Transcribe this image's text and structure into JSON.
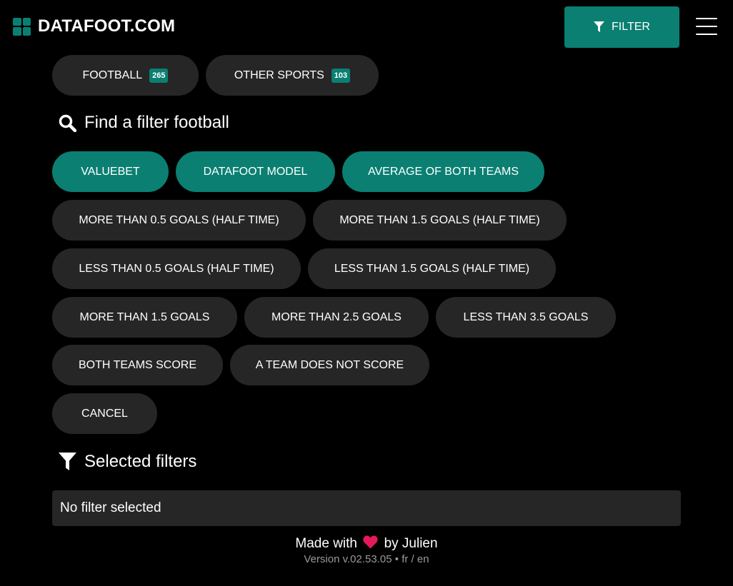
{
  "header": {
    "brand": "DATAFOOT.COM",
    "filter_label": "FILTER",
    "icons": {
      "logo": "grid-logo-icon",
      "filter": "funnel-icon",
      "menu": "hamburger-icon"
    }
  },
  "sport_tabs": [
    {
      "label": "FOOTBALL",
      "count": "265"
    },
    {
      "label": "OTHER SPORTS",
      "count": "103"
    }
  ],
  "find_section": {
    "title": "Find a filter football",
    "icon": "search-icon"
  },
  "filters": [
    {
      "label": "VALUEBET",
      "active": true
    },
    {
      "label": "DATAFOOT MODEL",
      "active": true
    },
    {
      "label": "AVERAGE OF BOTH TEAMS",
      "active": true
    },
    {
      "label": "MORE THAN 0.5 GOALS (HALF TIME)",
      "active": false
    },
    {
      "label": "MORE THAN 1.5 GOALS (HALF TIME)",
      "active": false
    },
    {
      "label": "LESS THAN 0.5 GOALS (HALF TIME)",
      "active": false
    },
    {
      "label": "LESS THAN 1.5 GOALS (HALF TIME)",
      "active": false
    },
    {
      "label": "MORE THAN 1.5 GOALS",
      "active": false
    },
    {
      "label": "MORE THAN 2.5 GOALS",
      "active": false
    },
    {
      "label": "LESS THAN 3.5 GOALS",
      "active": false
    },
    {
      "label": "BOTH TEAMS SCORE",
      "active": false
    },
    {
      "label": "A TEAM DOES NOT SCORE",
      "active": false
    },
    {
      "label": "CANCEL",
      "active": false
    }
  ],
  "selected_section": {
    "title": "Selected filters",
    "icon": "funnel-icon",
    "empty_text": "No filter selected"
  },
  "footer": {
    "made_with": "Made with",
    "by": "by Julien",
    "heart_icon": "heart-icon",
    "version": "Version v.02.53.05",
    "separator": "•",
    "lang_fr": "fr",
    "lang_sep": "/",
    "lang_en": "en"
  },
  "colors": {
    "accent": "#0a7f72",
    "pill": "#262626",
    "background": "#000000",
    "heart": "#e8195a"
  }
}
